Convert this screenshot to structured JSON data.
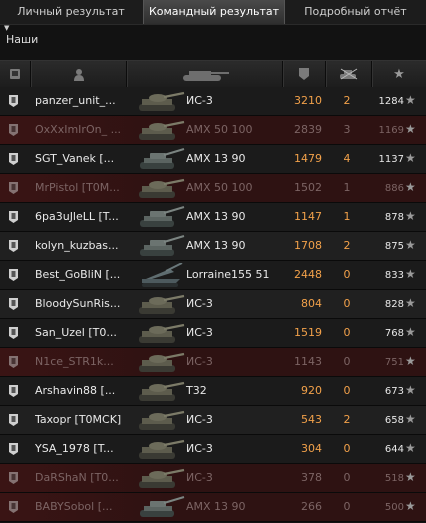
{
  "tabs": [
    {
      "label": "Личный результат",
      "active": false
    },
    {
      "label": "Командный результат",
      "active": true
    },
    {
      "label": "Подробный отчёт",
      "active": false
    }
  ],
  "team_label": "Наши",
  "columns": [
    {
      "icon": "vehicle-type-icon"
    },
    {
      "icon": "player-icon"
    },
    {
      "icon": "tank-icon"
    },
    {
      "icon": "damage-icon"
    },
    {
      "icon": "kills-icon"
    },
    {
      "icon": "experience-star-icon"
    }
  ],
  "colors": {
    "damage": "#f2a14a",
    "dead_row": "#3a1414"
  },
  "players": [
    {
      "name": "panzer_unit_...",
      "tank": "ИС-3",
      "damage": "3210",
      "kills": "2",
      "xp": "1284",
      "dead": false,
      "tank_shape": "heavy"
    },
    {
      "name": "OxXxImIrOn_ ...",
      "tank": "AMX 50 100",
      "damage": "2839",
      "kills": "3",
      "xp": "1169",
      "dead": true,
      "tank_shape": "heavy"
    },
    {
      "name": "SGT_Vanek [...",
      "tank": "AMX 13 90",
      "damage": "1479",
      "kills": "4",
      "xp": "1137",
      "dead": false,
      "tank_shape": "light"
    },
    {
      "name": "MrPistol [T0M...",
      "tank": "AMX 50 100",
      "damage": "1502",
      "kills": "1",
      "xp": "886",
      "dead": true,
      "tank_shape": "heavy"
    },
    {
      "name": "6pa3uJleLL [T...",
      "tank": "AMX 13 90",
      "damage": "1147",
      "kills": "1",
      "xp": "878",
      "dead": false,
      "tank_shape": "light"
    },
    {
      "name": "kolyn_kuzbas...",
      "tank": "AMX 13 90",
      "damage": "1708",
      "kills": "2",
      "xp": "875",
      "dead": false,
      "tank_shape": "light"
    },
    {
      "name": "Best_GoBliN [...",
      "tank": "Lorraine155 51",
      "damage": "2448",
      "kills": "0",
      "xp": "833",
      "dead": false,
      "tank_shape": "arty"
    },
    {
      "name": "BloodySunRis...",
      "tank": "ИС-3",
      "damage": "804",
      "kills": "0",
      "xp": "828",
      "dead": false,
      "tank_shape": "heavy"
    },
    {
      "name": "San_Uzel [T0...",
      "tank": "ИС-3",
      "damage": "1519",
      "kills": "0",
      "xp": "768",
      "dead": false,
      "tank_shape": "heavy"
    },
    {
      "name": "N1ce_STR1k...",
      "tank": "ИС-3",
      "damage": "1143",
      "kills": "0",
      "xp": "751",
      "dead": true,
      "tank_shape": "heavy"
    },
    {
      "name": "Arshavin88 [...",
      "tank": "T32",
      "damage": "920",
      "kills": "0",
      "xp": "673",
      "dead": false,
      "tank_shape": "heavy"
    },
    {
      "name": "Taxopr [T0MCK]",
      "tank": "ИС-3",
      "damage": "543",
      "kills": "2",
      "xp": "658",
      "dead": false,
      "tank_shape": "heavy"
    },
    {
      "name": "YSA_1978 [T...",
      "tank": "ИС-3",
      "damage": "304",
      "kills": "0",
      "xp": "644",
      "dead": false,
      "tank_shape": "heavy"
    },
    {
      "name": "DaRShaN [T0...",
      "tank": "ИС-3",
      "damage": "378",
      "kills": "0",
      "xp": "518",
      "dead": true,
      "tank_shape": "heavy"
    },
    {
      "name": "BABYSobol [...",
      "tank": "AMX 13 90",
      "damage": "266",
      "kills": "0",
      "xp": "500",
      "dead": true,
      "tank_shape": "light"
    }
  ]
}
